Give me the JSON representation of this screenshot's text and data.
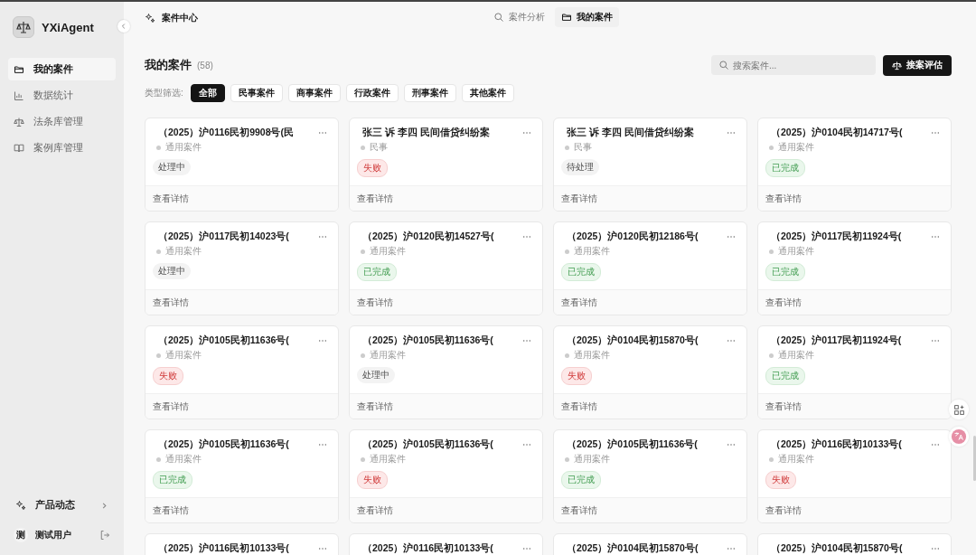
{
  "sidebar": {
    "brand": "YXiAgent",
    "items": [
      {
        "label": "我的案件",
        "selected": true
      },
      {
        "label": "数据统计",
        "selected": false
      },
      {
        "label": "法条库管理",
        "selected": false
      },
      {
        "label": "案例库管理",
        "selected": false
      }
    ],
    "news": "产品动态",
    "user": {
      "avatar": "测",
      "name": "测试用户"
    }
  },
  "topbar": {
    "title": "案件中心",
    "tabs": [
      {
        "label": "案件分析",
        "selected": false
      },
      {
        "label": "我的案件",
        "selected": true
      }
    ]
  },
  "page": {
    "title": "我的案件",
    "count": "(58)",
    "search": {
      "placeholder": "搜索案件..."
    },
    "action": "接案评估"
  },
  "filters": {
    "label": "类型筛选:",
    "options": [
      {
        "label": "全部",
        "selected": true
      },
      {
        "label": "民事案件",
        "selected": false
      },
      {
        "label": "商事案件",
        "selected": false
      },
      {
        "label": "行政案件",
        "selected": false
      },
      {
        "label": "刑事案件",
        "selected": false
      },
      {
        "label": "其他案件",
        "selected": false
      }
    ]
  },
  "cards": [
    {
      "title": "（2025）沪0116民初9908号(民",
      "type": "通用案件",
      "status": {
        "kind": "processing",
        "label": "处理中"
      },
      "link": "查看详情"
    },
    {
      "title": "张三 诉 李四 民间借贷纠纷案",
      "type": "民事",
      "status": {
        "kind": "failed",
        "label": "失败"
      },
      "link": "查看详情"
    },
    {
      "title": "张三 诉 李四 民间借贷纠纷案",
      "type": "民事",
      "status": {
        "kind": "pending",
        "label": "待处理"
      },
      "link": "查看详情"
    },
    {
      "title": "（2025）沪0104民初14717号(",
      "type": "通用案件",
      "status": {
        "kind": "done",
        "label": "已完成"
      },
      "link": "查看详情"
    },
    {
      "title": "（2025）沪0117民初14023号(",
      "type": "通用案件",
      "status": {
        "kind": "processing",
        "label": "处理中"
      },
      "link": "查看详情"
    },
    {
      "title": "（2025）沪0120民初14527号(",
      "type": "通用案件",
      "status": {
        "kind": "done",
        "label": "已完成"
      },
      "link": "查看详情"
    },
    {
      "title": "（2025）沪0120民初12186号(",
      "type": "通用案件",
      "status": {
        "kind": "done",
        "label": "已完成"
      },
      "link": "查看详情"
    },
    {
      "title": "（2025）沪0117民初11924号(",
      "type": "通用案件",
      "status": {
        "kind": "done",
        "label": "已完成"
      },
      "link": "查看详情"
    },
    {
      "title": "（2025）沪0105民初11636号(",
      "type": "通用案件",
      "status": {
        "kind": "failed",
        "label": "失败"
      },
      "link": "查看详情"
    },
    {
      "title": "（2025）沪0105民初11636号(",
      "type": "通用案件",
      "status": {
        "kind": "processing",
        "label": "处理中"
      },
      "link": "查看详情"
    },
    {
      "title": "（2025）沪0104民初15870号(",
      "type": "通用案件",
      "status": {
        "kind": "failed",
        "label": "失败"
      },
      "link": "查看详情"
    },
    {
      "title": "（2025）沪0117民初11924号(",
      "type": "通用案件",
      "status": {
        "kind": "done",
        "label": "已完成"
      },
      "link": "查看详情"
    },
    {
      "title": "（2025）沪0105民初11636号(",
      "type": "通用案件",
      "status": {
        "kind": "done",
        "label": "已完成"
      },
      "link": "查看详情"
    },
    {
      "title": "（2025）沪0105民初11636号(",
      "type": "通用案件",
      "status": {
        "kind": "failed",
        "label": "失败"
      },
      "link": "查看详情"
    },
    {
      "title": "（2025）沪0105民初11636号(",
      "type": "通用案件",
      "status": {
        "kind": "done",
        "label": "已完成"
      },
      "link": "查看详情"
    },
    {
      "title": "（2025）沪0116民初10133号(",
      "type": "通用案件",
      "status": {
        "kind": "failed",
        "label": "失败"
      },
      "link": "查看详情"
    },
    {
      "title": "（2025）沪0116民初10133号("
    },
    {
      "title": "（2025）沪0116民初10133号("
    },
    {
      "title": "（2025）沪0104民初15870号("
    },
    {
      "title": "（2025）沪0104民初15870号("
    }
  ]
}
